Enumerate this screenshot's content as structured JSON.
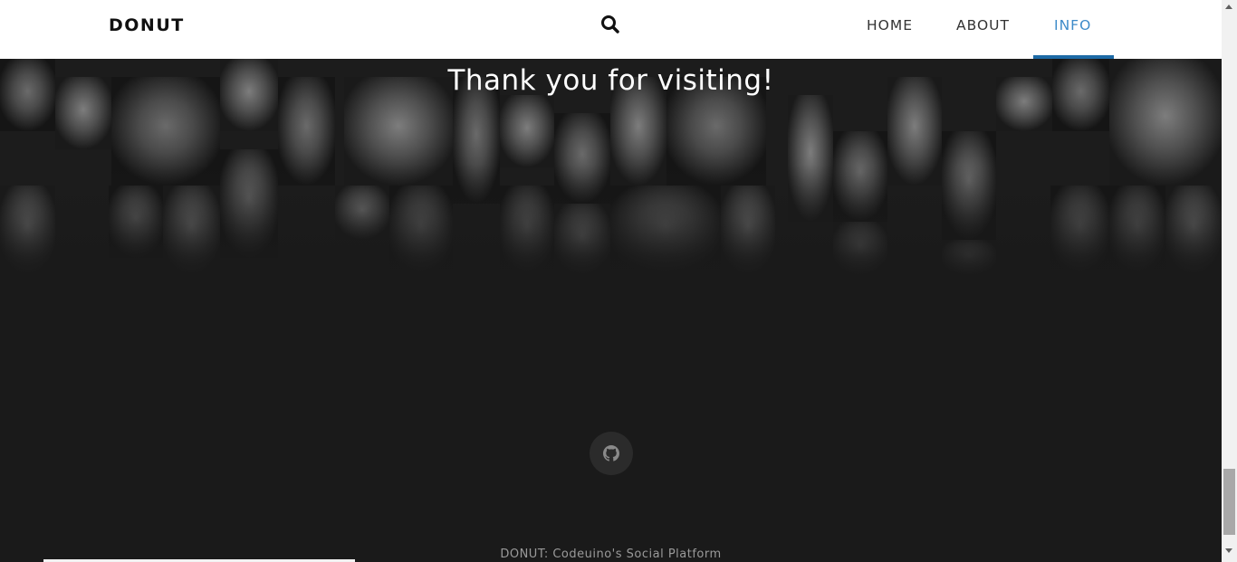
{
  "header": {
    "brand": "DONUT",
    "search_icon": "search-icon",
    "nav": [
      {
        "label": "HOME"
      },
      {
        "label": "ABOUT"
      },
      {
        "label": "INFO",
        "active": true
      }
    ]
  },
  "hero": {
    "title": "Thank you for visiting!",
    "background": "black-and-white face mosaic"
  },
  "social": {
    "github_icon": "github-icon"
  },
  "footer": {
    "text": "DONUT: Codeuino's Social Platform"
  },
  "colors": {
    "accent": "#3d8bc9",
    "underline": "#1d6aa6",
    "page_bg": "#1a1a1a"
  }
}
